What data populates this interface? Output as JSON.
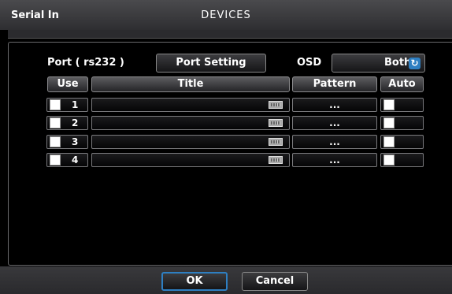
{
  "header": {
    "app_name": "Serial In",
    "title": "DEVICES"
  },
  "port": {
    "label": "Port ( rs232 )",
    "setting_button": "Port Setting"
  },
  "osd": {
    "label": "OSD",
    "value": "Both"
  },
  "table": {
    "columns": {
      "use": "Use",
      "title": "Title",
      "pattern": "Pattern",
      "auto": "Auto"
    },
    "rows": [
      {
        "number": "1",
        "title": "",
        "pattern": "...",
        "use": false,
        "auto": false
      },
      {
        "number": "2",
        "title": "",
        "pattern": "...",
        "use": false,
        "auto": false
      },
      {
        "number": "3",
        "title": "",
        "pattern": "...",
        "use": false,
        "auto": false
      },
      {
        "number": "4",
        "title": "",
        "pattern": "...",
        "use": false,
        "auto": false
      }
    ]
  },
  "footer": {
    "ok_label": "OK",
    "cancel_label": "Cancel"
  },
  "colors": {
    "accent": "#2e7fc2",
    "checkbox": "#ffffff",
    "background": "#000000"
  }
}
